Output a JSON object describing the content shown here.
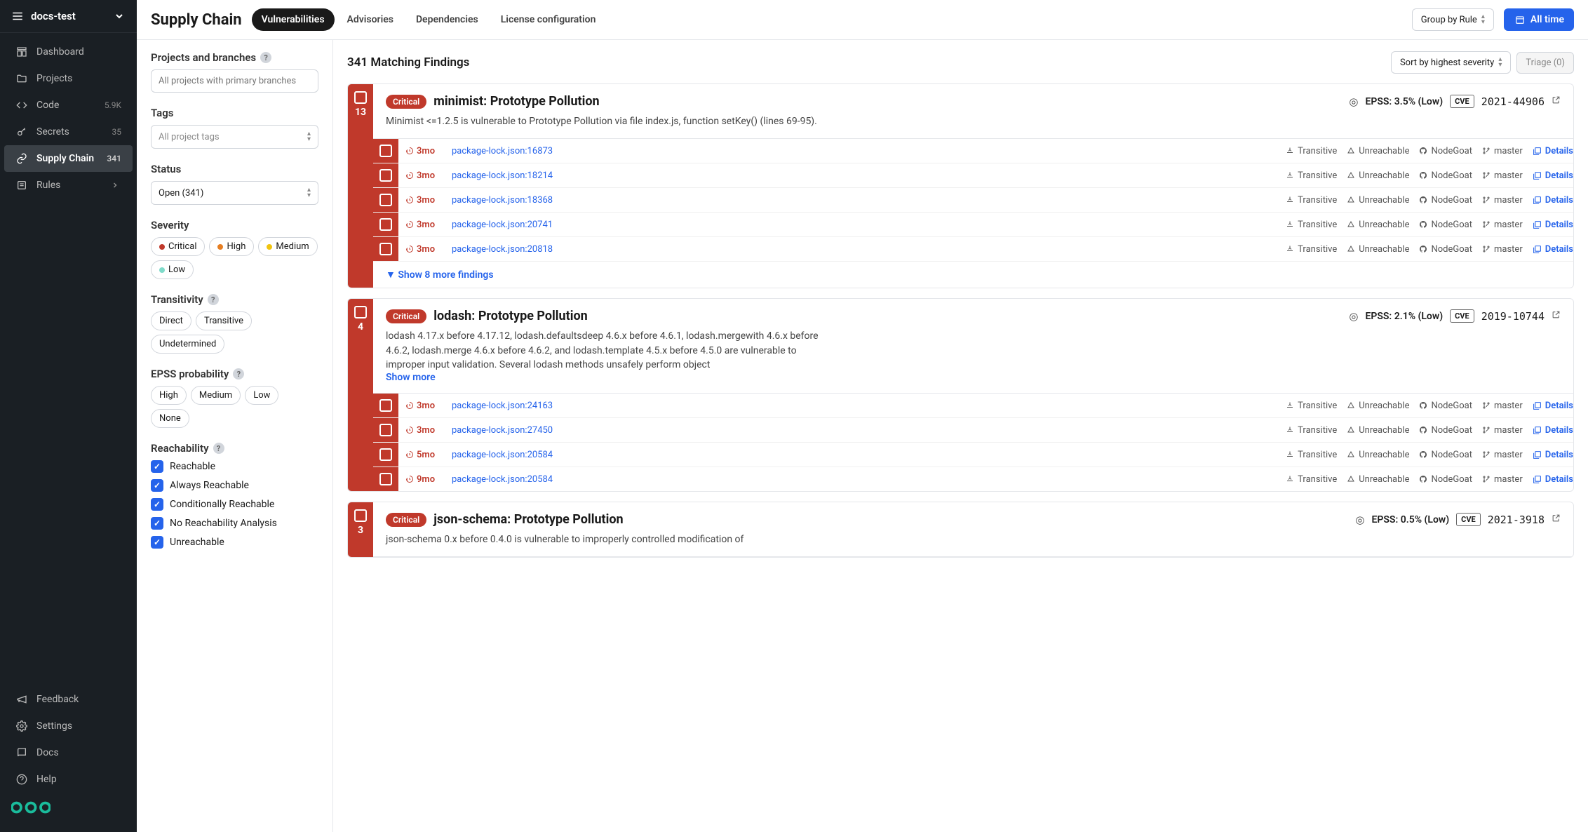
{
  "header": {
    "workspace": "docs-test"
  },
  "sidebar": {
    "items": [
      {
        "label": "Dashboard"
      },
      {
        "label": "Projects"
      },
      {
        "label": "Code",
        "count": "5.9K"
      },
      {
        "label": "Secrets",
        "count": "35"
      },
      {
        "label": "Supply Chain",
        "count": "341",
        "active": true
      },
      {
        "label": "Rules"
      }
    ],
    "footer": [
      {
        "label": "Feedback"
      },
      {
        "label": "Settings"
      },
      {
        "label": "Docs"
      },
      {
        "label": "Help"
      }
    ]
  },
  "page": {
    "title": "Supply Chain",
    "tabs": [
      "Vulnerabilities",
      "Advisories",
      "Dependencies",
      "License configuration"
    ],
    "active_tab": 0,
    "group_by": "Group by Rule",
    "time_filter": "All time"
  },
  "filters": {
    "projects": {
      "label": "Projects and branches",
      "placeholder": "All projects with primary branches"
    },
    "tags": {
      "label": "Tags",
      "placeholder": "All project tags"
    },
    "status": {
      "label": "Status",
      "value": "Open (341)"
    },
    "severity": {
      "label": "Severity",
      "options": [
        {
          "label": "Critical",
          "color": "#c0392b"
        },
        {
          "label": "High",
          "color": "#e67e22"
        },
        {
          "label": "Medium",
          "color": "#f1c40f"
        },
        {
          "label": "Low",
          "color": "#7fdbca"
        }
      ]
    },
    "transitivity": {
      "label": "Transitivity",
      "options": [
        "Direct",
        "Transitive",
        "Undetermined"
      ]
    },
    "epss": {
      "label": "EPSS probability",
      "options": [
        "High",
        "Medium",
        "Low",
        "None"
      ]
    },
    "reachability": {
      "label": "Reachability",
      "options": [
        "Reachable",
        "Always Reachable",
        "Conditionally Reachable",
        "No Reachability Analysis",
        "Unreachable"
      ]
    }
  },
  "results": {
    "heading": "341 Matching Findings",
    "sort": "Sort by highest severity",
    "triage": "Triage (0)",
    "groups": [
      {
        "count": 13,
        "severity": "Critical",
        "title": "minimist: Prototype Pollution",
        "epss": "EPSS: 3.5% (Low)",
        "cve": "2021-44906",
        "desc": "Minimist <=1.2.5 is vulnerable to Prototype Pollution via file index.js, function setKey() (lines 69-95).",
        "rows": [
          {
            "age": "3mo",
            "link": "package-lock.json:16873"
          },
          {
            "age": "3mo",
            "link": "package-lock.json:18214"
          },
          {
            "age": "3mo",
            "link": "package-lock.json:18368"
          },
          {
            "age": "3mo",
            "link": "package-lock.json:20741"
          },
          {
            "age": "3mo",
            "link": "package-lock.json:20818"
          }
        ],
        "more": "Show 8 more findings"
      },
      {
        "count": 4,
        "severity": "Critical",
        "title": "lodash: Prototype Pollution",
        "epss": "EPSS: 2.1% (Low)",
        "cve": "2019-10744",
        "desc": "lodash 4.17.x before 4.17.12, lodash.defaultsdeep 4.6.x before 4.6.1, lodash.mergewith 4.6.x before 4.6.2, lodash.merge 4.6.x before 4.6.2, and lodash.template 4.5.x before 4.5.0 are vulnerable to improper input validation. Several lodash methods unsafely perform object",
        "show_more_desc": "Show more",
        "rows": [
          {
            "age": "3mo",
            "link": "package-lock.json:24163"
          },
          {
            "age": "3mo",
            "link": "package-lock.json:27450"
          },
          {
            "age": "5mo",
            "link": "package-lock.json:20584"
          },
          {
            "age": "9mo",
            "link": "package-lock.json:20584"
          }
        ]
      },
      {
        "count": 3,
        "severity": "Critical",
        "title": "json-schema: Prototype Pollution",
        "epss": "EPSS: 0.5% (Low)",
        "cve": "2021-3918",
        "desc": "json-schema 0.x before 0.4.0 is vulnerable to improperly controlled modification of"
      }
    ],
    "row_meta": {
      "transitive": "Transitive",
      "unreachable": "Unreachable",
      "repo": "NodeGoat",
      "branch": "master",
      "details": "Details",
      "cve_label": "CVE"
    }
  }
}
